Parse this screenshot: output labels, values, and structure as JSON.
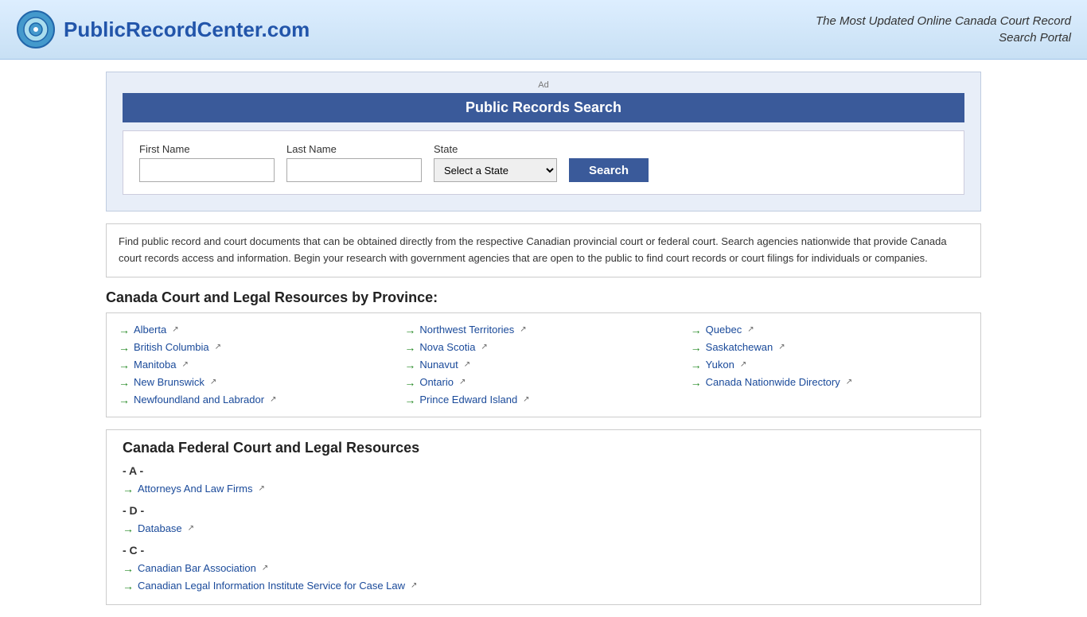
{
  "header": {
    "site_name": "PublicRecordCenter.com",
    "tagline_line1": "The Most Updated Online Canada Court Record",
    "tagline_line2": "Search Portal"
  },
  "ad": {
    "label": "Ad",
    "widget_title": "Public Records Search",
    "form": {
      "first_name_label": "First Name",
      "last_name_label": "Last Name",
      "state_label": "State",
      "state_placeholder": "Select a State",
      "search_button": "Search"
    }
  },
  "description": "Find public record and court documents that can be obtained directly from the respective Canadian provincial court or federal court. Search agencies nationwide that provide Canada court records access and information. Begin your research with government agencies that are open to the public to find court records or court filings for individuals or companies.",
  "province_section": {
    "title": "Canada Court and Legal Resources by Province:",
    "col1": [
      {
        "name": "Alberta",
        "url": "#"
      },
      {
        "name": "British Columbia",
        "url": "#"
      },
      {
        "name": "Manitoba",
        "url": "#"
      },
      {
        "name": "New Brunswick",
        "url": "#"
      },
      {
        "name": "Newfoundland and Labrador",
        "url": "#"
      }
    ],
    "col2": [
      {
        "name": "Northwest Territories",
        "url": "#"
      },
      {
        "name": "Nova Scotia",
        "url": "#"
      },
      {
        "name": "Nunavut",
        "url": "#"
      },
      {
        "name": "Ontario",
        "url": "#"
      },
      {
        "name": "Prince Edward Island",
        "url": "#"
      }
    ],
    "col3": [
      {
        "name": "Quebec",
        "url": "#"
      },
      {
        "name": "Saskatchewan",
        "url": "#"
      },
      {
        "name": "Yukon",
        "url": "#"
      },
      {
        "name": "Canada Nationwide Directory",
        "url": "#"
      }
    ]
  },
  "federal_section": {
    "title": "Canada Federal Court and Legal Resources",
    "sections": [
      {
        "letter": "- A -",
        "items": [
          {
            "name": "Attorneys And Law Firms",
            "url": "#"
          }
        ]
      },
      {
        "letter": "- D -",
        "items": [
          {
            "name": "Database",
            "url": "#"
          }
        ]
      },
      {
        "letter": "- C -",
        "items": [
          {
            "name": "Canadian Bar Association",
            "url": "#"
          },
          {
            "name": "Canadian Legal Information Institute Service for Case Law",
            "url": "#"
          }
        ]
      }
    ]
  },
  "icons": {
    "arrow": "→",
    "external": "↗",
    "logo_color_outer": "#4499cc",
    "logo_color_inner": "#1a66aa"
  }
}
